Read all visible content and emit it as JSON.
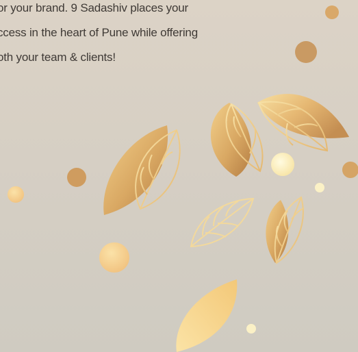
{
  "text": {
    "lines": [
      "or your brand. 9 Sadashiv places your",
      "ccess in the heart of Pune while offering",
      "oth your team & clients!"
    ]
  },
  "colors": {
    "background_top": "#dcd3c6",
    "background_bottom": "#cfcbc1",
    "text": "#3f3a36",
    "gold_light": "#f6dfa0",
    "gold_mid": "#e2b46c",
    "gold_dark": "#b98549",
    "dot_pale": "#fbf0c2"
  },
  "decor": {
    "leaf_icon": "leaf-icon",
    "dot_icon": "dot-icon"
  }
}
